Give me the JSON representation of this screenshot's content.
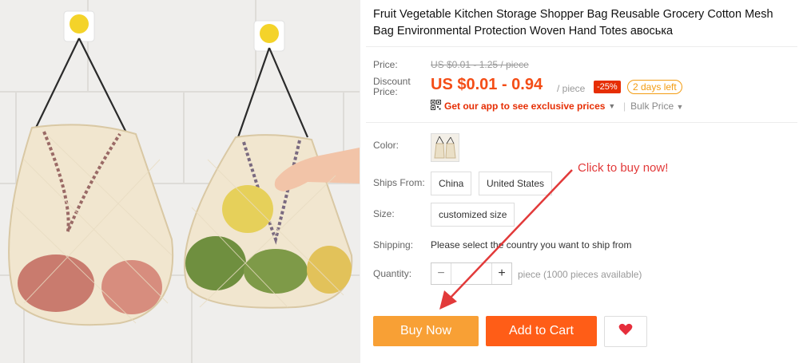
{
  "product": {
    "title": "Fruit Vegetable Kitchen Storage Shopper Bag Reusable Grocery Cotton Mesh Bag Environmental Protection Woven Hand Totes авоська"
  },
  "price": {
    "label": "Price:",
    "original": "US $0.01 - 1.25 / piece",
    "discount_label_1": "Discount",
    "discount_label_2": "Price:",
    "discount_value": "US $0.01 - 0.94",
    "unit": "/ piece",
    "discount_badge": "-25%",
    "time_left": "2 days left",
    "app_link": "Get our app to see exclusive prices",
    "bulk_price": "Bulk Price"
  },
  "options": {
    "color_label": "Color:",
    "ships_from_label": "Ships From:",
    "ships_from": [
      "China",
      "United States"
    ],
    "size_label": "Size:",
    "size": "customized size",
    "shipping_label": "Shipping:",
    "shipping_text": "Please select the country you want to ship from",
    "quantity_label": "Quantity:",
    "quantity_value": "",
    "minus": "−",
    "plus": "+",
    "availability": "piece (1000 pieces available)"
  },
  "actions": {
    "buy_now": "Buy Now",
    "add_to_cart": "Add to Cart"
  },
  "annotation": {
    "callout": "Click to buy now!"
  },
  "colors": {
    "price": "#f44d16",
    "buy_now": "#f8a035",
    "add_to_cart": "#ff5d17",
    "callout": "#e23a3a"
  },
  "icons": [
    "qr-code-icon",
    "heart-icon",
    "caret-down-icon"
  ]
}
